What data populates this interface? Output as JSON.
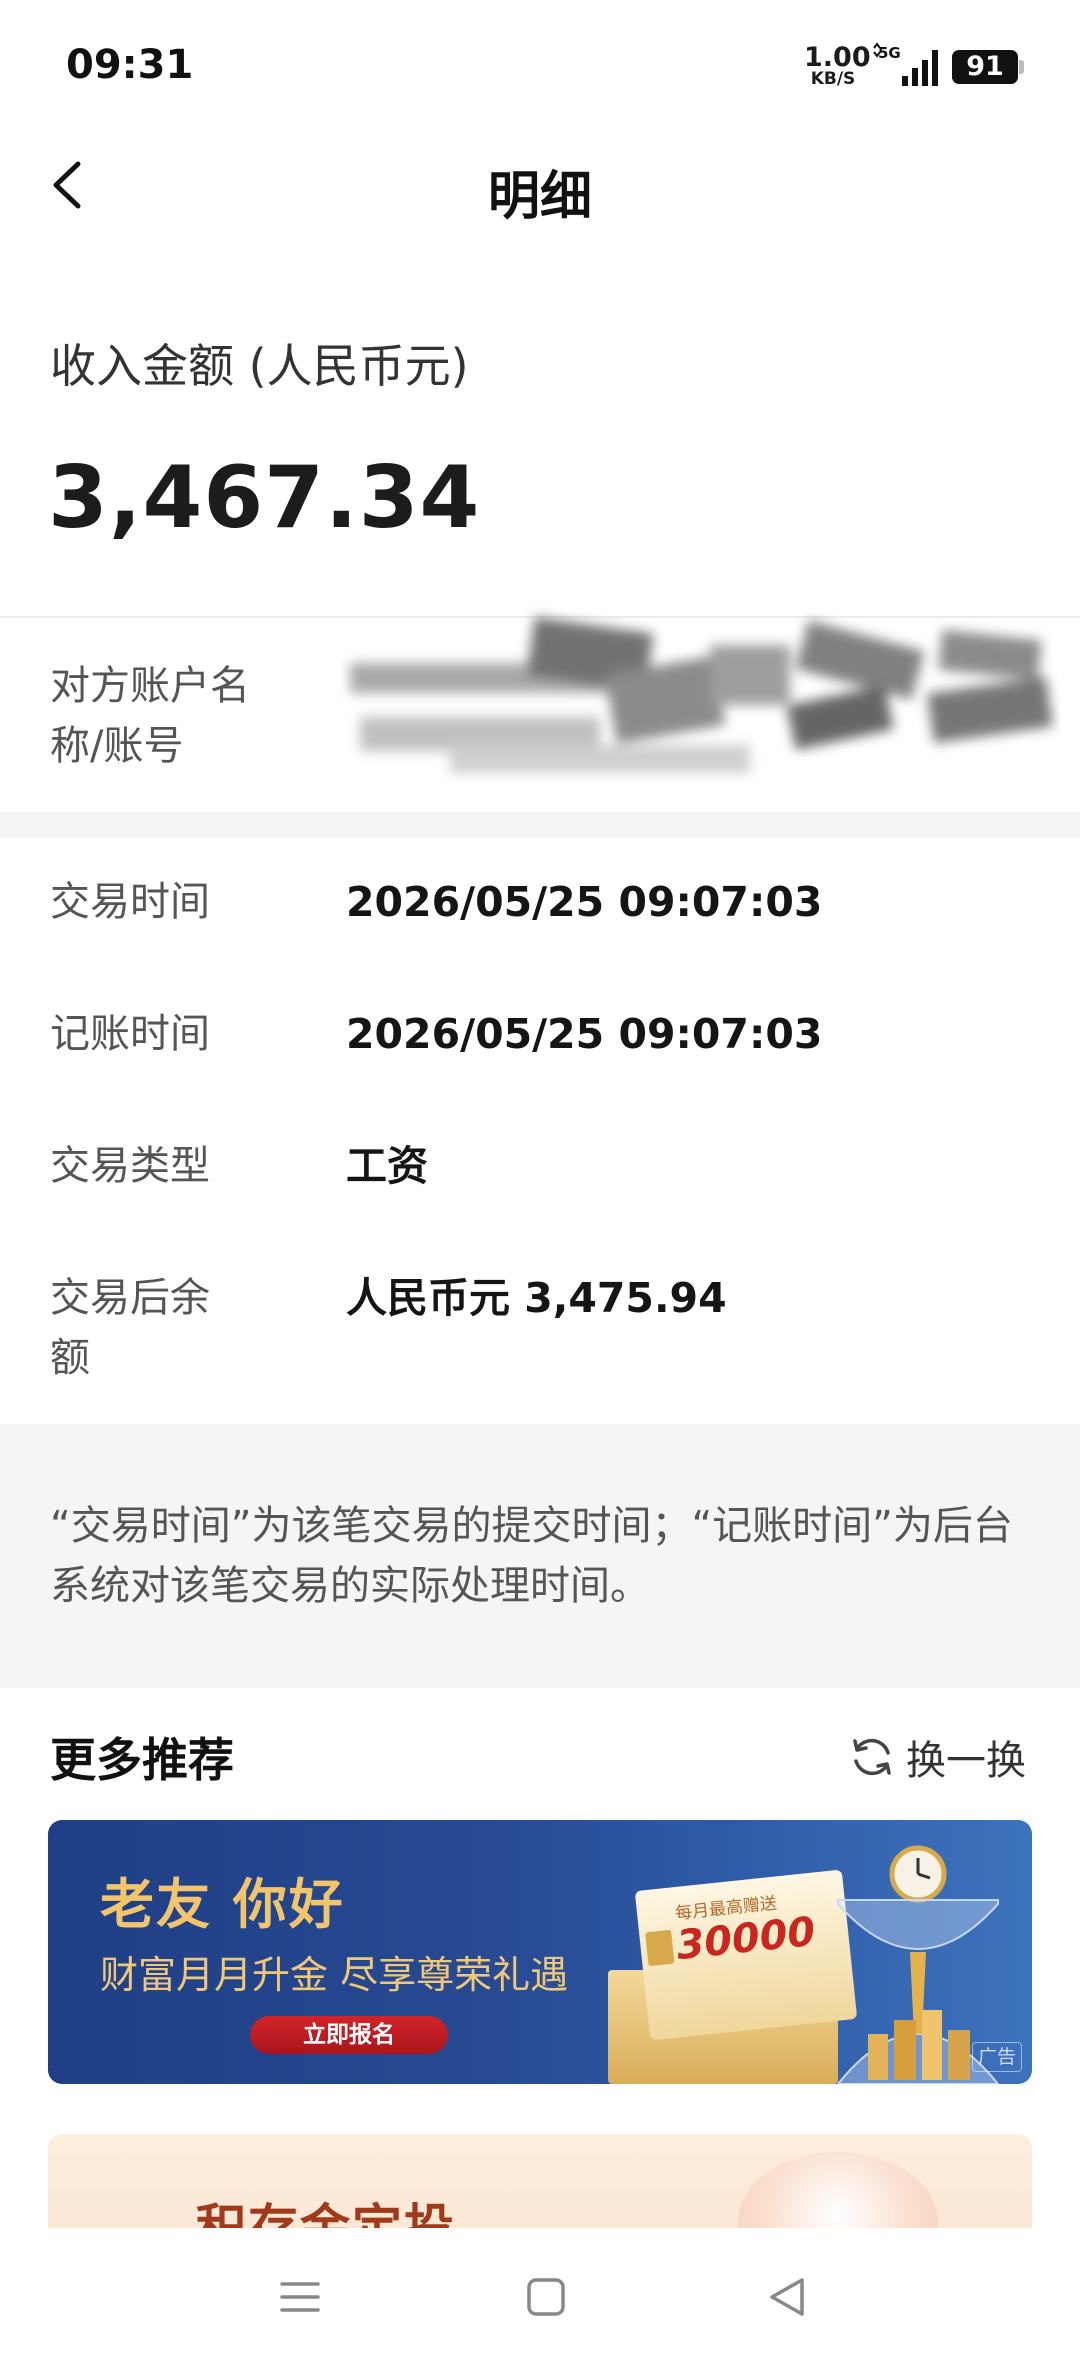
{
  "status_bar": {
    "time": "09:31",
    "net_speed_value": "1.00",
    "net_speed_unit": "KB/S",
    "network_type": "5G",
    "battery": "91"
  },
  "header": {
    "title": "明细"
  },
  "amount": {
    "label": "收入金额 (人民币元)",
    "value": "3,467.34"
  },
  "counterparty": {
    "label": "对方账户名称/账号",
    "value_redacted": true
  },
  "details": [
    {
      "label": "交易时间",
      "value": "2026/05/25 09:07:03"
    },
    {
      "label": "记账时间",
      "value": "2026/05/25 09:07:03"
    },
    {
      "label": "交易类型",
      "value": "工资"
    },
    {
      "label": "交易后余额",
      "value": "人民币元 3,475.94"
    }
  ],
  "note": "“交易时间”为该笔交易的提交时间；“记账时间”为后台系统对该笔交易的实际处理时间。",
  "recommend": {
    "title": "更多推荐",
    "refresh_label": "换一换"
  },
  "banner1": {
    "headline": "老友 你好",
    "subline": "财富月月升金 尽享尊荣礼遇",
    "button": "立即报名",
    "card_caption": "每月最高赠送",
    "card_amount": "30000",
    "ad_tag": "广告",
    "colors": {
      "background": "#274a92",
      "accent": "#f2c56a",
      "button": "#c81e24"
    }
  },
  "banner2": {
    "headline": "积存金定投"
  },
  "nav_bar": {
    "icons": [
      "menu-icon",
      "home-square-icon",
      "back-triangle-icon"
    ]
  }
}
